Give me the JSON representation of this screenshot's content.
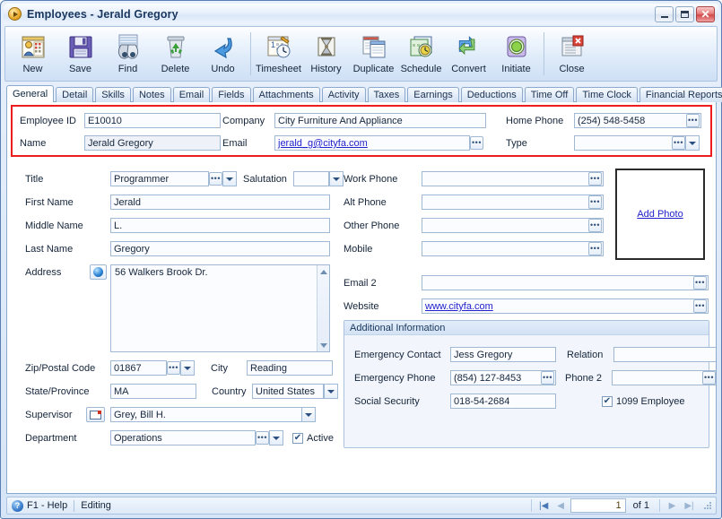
{
  "window": {
    "title": "Employees - Jerald Gregory",
    "icon": "play-circle-icon",
    "minimize": "minimize-icon",
    "maximize": "maximize-icon",
    "close": "close-icon",
    "accent": "#ee1c1c"
  },
  "toolbar": {
    "buttons": [
      {
        "label": "New",
        "icon": "new-record-icon"
      },
      {
        "label": "Save",
        "icon": "save-floppy-icon"
      },
      {
        "label": "Find",
        "icon": "find-binoculars-icon"
      },
      {
        "label": "Delete",
        "icon": "delete-recycle-icon"
      },
      {
        "label": "Undo",
        "icon": "undo-arrow-icon"
      },
      {
        "label": "Timesheet",
        "icon": "timesheet-icon"
      },
      {
        "label": "History",
        "icon": "history-hourglass-icon"
      },
      {
        "label": "Duplicate",
        "icon": "duplicate-icon"
      },
      {
        "label": "Schedule",
        "icon": "schedule-icon"
      },
      {
        "label": "Convert",
        "icon": "convert-arrows-icon"
      },
      {
        "label": "Initiate",
        "icon": "initiate-icon"
      },
      {
        "label": "Close",
        "icon": "close-window-icon"
      }
    ]
  },
  "tabs": [
    {
      "label": "General",
      "active": true
    },
    {
      "label": "Detail",
      "active": false
    },
    {
      "label": "Skills",
      "active": false
    },
    {
      "label": "Notes",
      "active": false
    },
    {
      "label": "Email",
      "active": false
    },
    {
      "label": "Fields",
      "active": false
    },
    {
      "label": "Attachments",
      "active": false
    },
    {
      "label": "Activity",
      "active": false
    },
    {
      "label": "Taxes",
      "active": false
    },
    {
      "label": "Earnings",
      "active": false
    },
    {
      "label": "Deductions",
      "active": false
    },
    {
      "label": "Time Off",
      "active": false
    },
    {
      "label": "Time Clock",
      "active": false
    },
    {
      "label": "Financial Reports",
      "active": false
    }
  ],
  "header": {
    "employee_id_label": "Employee ID",
    "employee_id_value": "E10010",
    "name_label": "Name",
    "name_value": "Jerald Gregory",
    "company_label": "Company",
    "company_value": "City Furniture And Appliance",
    "email_label": "Email",
    "email_value": "jerald_g@cityfa.com",
    "home_phone_label": "Home Phone",
    "home_phone_value": "(254) 548-5458",
    "type_label": "Type",
    "type_value": ""
  },
  "left": {
    "title_label": "Title",
    "title_value": "Programmer",
    "salutation_label": "Salutation",
    "salutation_value": "",
    "first_name_label": "First Name",
    "first_name_value": "Jerald",
    "middle_name_label": "Middle Name",
    "middle_name_value": "L.",
    "last_name_label": "Last Name",
    "last_name_value": "Gregory",
    "address_label": "Address",
    "address_value": "56 Walkers Brook Dr.",
    "zip_label": "Zip/Postal Code",
    "zip_value": "01867",
    "city_label": "City",
    "city_value": "Reading",
    "state_label": "State/Province",
    "state_value": "MA",
    "country_label": "Country",
    "country_value": "United States",
    "supervisor_label": "Supervisor",
    "supervisor_value": "Grey, Bill H.",
    "department_label": "Department",
    "department_value": "Operations",
    "active_label": "Active",
    "active_checked": true
  },
  "right": {
    "work_phone_label": "Work Phone",
    "work_phone_value": "",
    "alt_phone_label": "Alt Phone",
    "alt_phone_value": "",
    "other_phone_label": "Other Phone",
    "other_phone_value": "",
    "mobile_label": "Mobile",
    "mobile_value": "",
    "email2_label": "Email 2",
    "email2_value": "",
    "website_label": "Website",
    "website_value": "www.cityfa.com",
    "photo_link": "Add Photo"
  },
  "additional": {
    "caption": "Additional Information",
    "emergency_contact_label": "Emergency Contact",
    "emergency_contact_value": "Jess Gregory",
    "relation_label": "Relation",
    "relation_value": "",
    "emergency_phone_label": "Emergency Phone",
    "emergency_phone_value": "(854) 127-8453",
    "phone2_label": "Phone 2",
    "phone2_value": "",
    "social_security_label": "Social Security",
    "social_security_value": "018-54-2684",
    "employee1099_label": "1099 Employee",
    "employee1099_checked": true
  },
  "status": {
    "help_icon": "help-icon",
    "help_label": "F1 - Help",
    "mode_label": "Editing",
    "first_icon": "first-record-icon",
    "prev_icon": "previous-record-icon",
    "record_value": "1",
    "of_label": "of 1",
    "next_icon": "next-record-icon",
    "last_icon": "last-record-icon"
  }
}
